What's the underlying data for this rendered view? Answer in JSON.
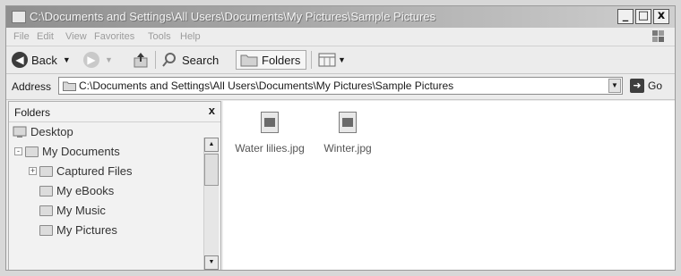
{
  "window": {
    "title": "C:\\Documents and Settings\\All Users\\Documents\\My Pictures\\Sample Pictures",
    "controls": {
      "minimize": "_",
      "maximize": "□",
      "close": "x"
    }
  },
  "menu": {
    "items": [
      "File",
      "Edit",
      "View",
      "Favorites",
      "Tools",
      "Help"
    ]
  },
  "toolbar": {
    "back_label": "Back",
    "search_label": "Search",
    "folders_label": "Folders"
  },
  "address": {
    "label": "Address",
    "value": "C:\\Documents and Settings\\All Users\\Documents\\My Pictures\\Sample Pictures",
    "go_label": "Go"
  },
  "folders_pane": {
    "title": "Folders",
    "close": "x",
    "items": [
      {
        "label": "Desktop",
        "indent": 0,
        "expander": ""
      },
      {
        "label": "My Documents",
        "indent": 1,
        "expander": "-"
      },
      {
        "label": "Captured Files",
        "indent": 2,
        "expander": "+"
      },
      {
        "label": "My eBooks",
        "indent": 2,
        "expander": ""
      },
      {
        "label": "My Music",
        "indent": 2,
        "expander": ""
      },
      {
        "label": "My Pictures",
        "indent": 2,
        "expander": ""
      }
    ]
  },
  "files": [
    {
      "name": "Water lilies.jpg"
    },
    {
      "name": "Winter.jpg"
    }
  ],
  "colors": {
    "window_bg": "#ececec",
    "titlebar": "#a9a9a9",
    "content_bg": "#ffffff"
  }
}
